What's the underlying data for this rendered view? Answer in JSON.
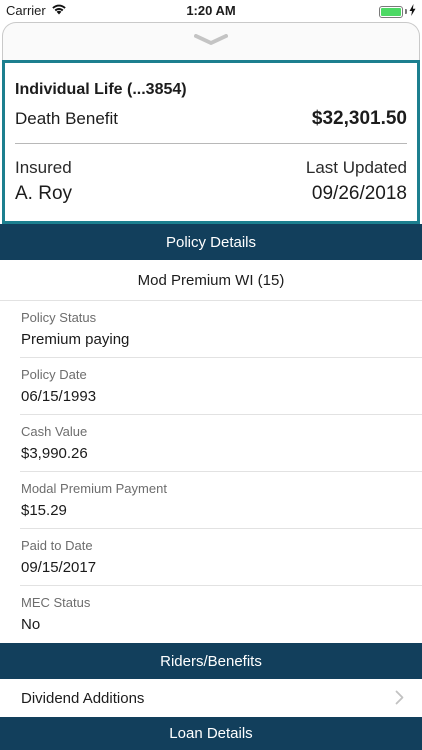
{
  "status_bar": {
    "carrier": "Carrier",
    "time": "1:20 AM",
    "battery_level": 1.0
  },
  "summary": {
    "title": "Individual Life (...3854)",
    "death_benefit_label": "Death Benefit",
    "death_benefit_value": "$32,301.50",
    "insured_label": "Insured",
    "insured_value": "A. Roy",
    "last_updated_label": "Last Updated",
    "last_updated_value": "09/26/2018"
  },
  "sections": {
    "policy_details": "Policy Details",
    "riders_benefits": "Riders/Benefits",
    "loan_details": "Loan Details"
  },
  "plan_name": "Mod Premium WI (15)",
  "fields": [
    {
      "label": "Policy Status",
      "value": "Premium paying"
    },
    {
      "label": "Policy Date",
      "value": "06/15/1993"
    },
    {
      "label": "Cash Value",
      "value": "$3,990.26"
    },
    {
      "label": "Modal Premium Payment",
      "value": "$15.29"
    },
    {
      "label": "Paid to Date",
      "value": "09/15/2017"
    },
    {
      "label": "MEC Status",
      "value": "No"
    }
  ],
  "riders": [
    {
      "label": "Dividend Additions"
    }
  ],
  "colors": {
    "header_bg": "#123f5c",
    "card_border": "#1c7f8f",
    "battery": "#4cd964"
  },
  "icons": {
    "wifi": "wifi-icon",
    "battery": "battery-icon",
    "charging": "charging-bolt-icon",
    "handle": "chevron-down-icon",
    "row": "chevron-right-icon"
  }
}
